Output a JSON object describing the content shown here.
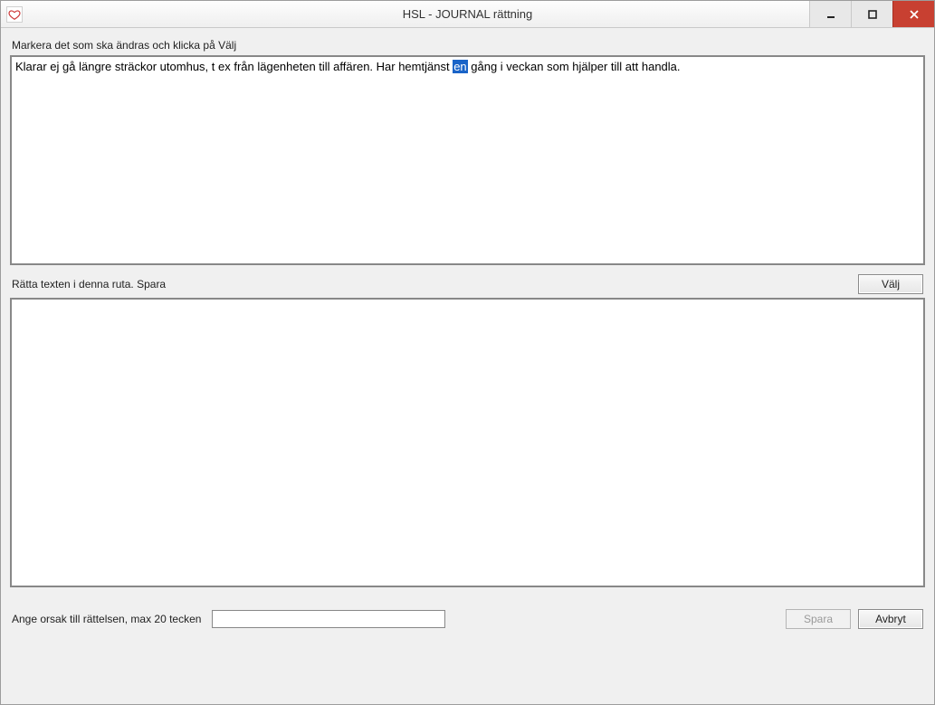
{
  "window": {
    "title": "HSL - JOURNAL rättning"
  },
  "labels": {
    "top_section": "Markera det som ska ändras och klicka på Välj",
    "mid_section": "Rätta texten i denna ruta. Spara",
    "select_button": "Välj",
    "reason": "Ange orsak till rättelsen, max 20 tecken",
    "save_button": "Spara",
    "cancel_button": "Avbryt"
  },
  "source_text": {
    "before": "Klarar ej gå längre sträckor utomhus, t ex från lägenheten till affären. Har hemtjänst ",
    "highlight": "en",
    "after": " gång i veckan som hjälper till att handla."
  },
  "edit_text": "",
  "reason_value": ""
}
